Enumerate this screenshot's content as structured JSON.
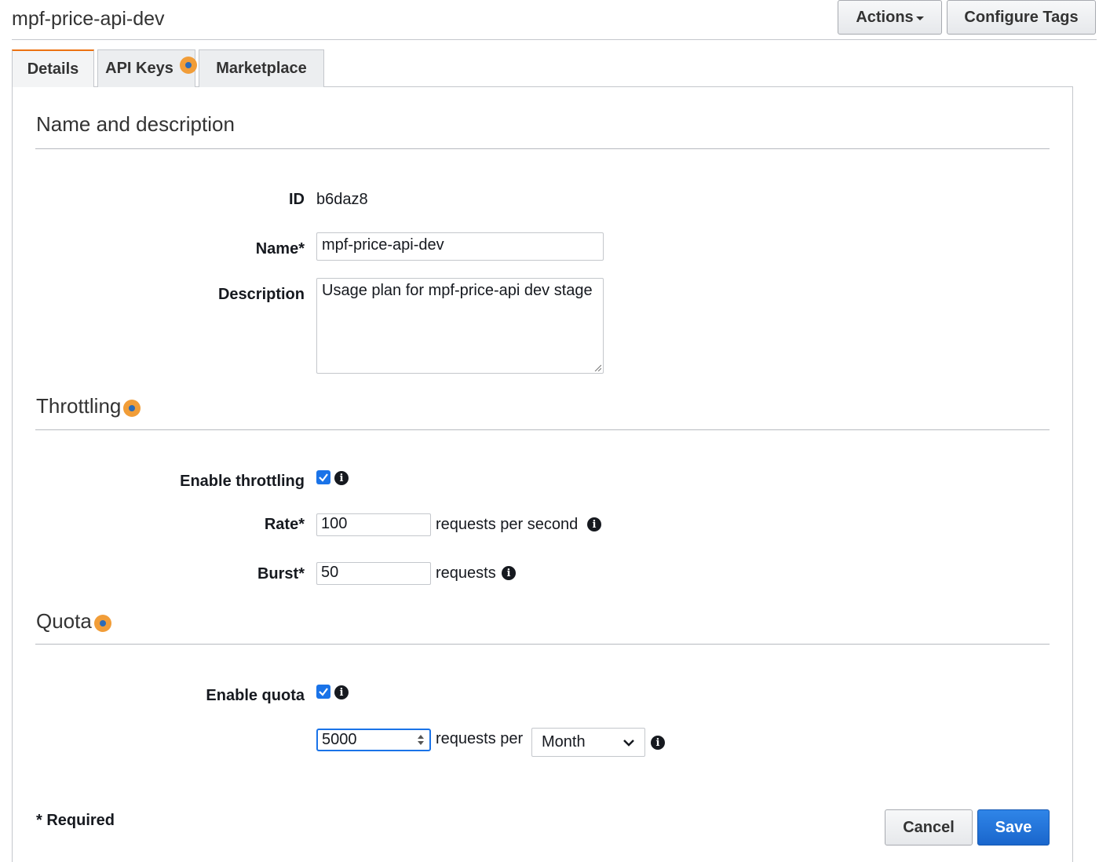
{
  "header": {
    "title": "mpf-price-api-dev",
    "actions_label": "Actions",
    "configure_tags_label": "Configure Tags"
  },
  "tabs": [
    {
      "label": "Details",
      "active": true
    },
    {
      "label": "API Keys",
      "active": false,
      "badge": true
    },
    {
      "label": "Marketplace",
      "active": false
    }
  ],
  "name_section": {
    "title": "Name and description",
    "id_label": "ID",
    "id_value": "b6daz8",
    "name_label": "Name*",
    "name_value": "mpf-price-api-dev",
    "description_label": "Description",
    "description_value": "Usage plan for mpf-price-api dev stage"
  },
  "throttling": {
    "title": "Throttling",
    "enable_label": "Enable throttling",
    "enabled": true,
    "rate_label": "Rate*",
    "rate_value": "100",
    "rate_unit": "requests per second",
    "burst_label": "Burst*",
    "burst_value": "50",
    "burst_unit": "requests"
  },
  "quota": {
    "title": "Quota",
    "enable_label": "Enable quota",
    "enabled": true,
    "value": "5000",
    "unit_text": "requests per",
    "period": "Month"
  },
  "footer": {
    "required_note": "* Required",
    "cancel_label": "Cancel",
    "save_label": "Save"
  },
  "colors": {
    "accent": "#1a73e8",
    "badge": "#f19d38",
    "tab_highlight": "#ec7211"
  }
}
